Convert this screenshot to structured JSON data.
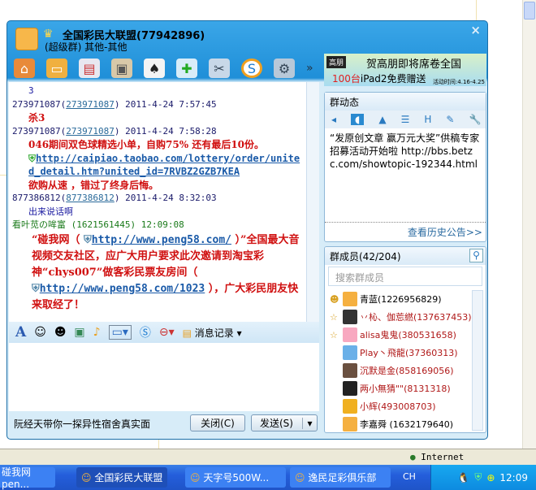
{
  "window": {
    "title": "全国彩民大联盟(77942896)",
    "subtitle": "(超级群) 其他-其他",
    "close": "×",
    "more": "»"
  },
  "chat": {
    "messages": [
      {
        "text": "3"
      },
      {
        "sender": "273971087",
        "id": "273971087",
        "time": "2011-4-24 7:57:45",
        "text": "杀3"
      },
      {
        "sender": "273971087",
        "id": "273971087",
        "time": "2011-4-24 7:58:28",
        "text": "046期间双色球精选小单，自购75%  还有最后10份。",
        "link": "http://caipiao.taobao.com/lottery/order/united_detail.htm?united_id=7RVBZ2GZB7KEA",
        "text2": "欲购从速 ，错过了终身后悔。"
      },
      {
        "sender": "877386812",
        "id": "877386812",
        "time": "2011-4-24 8:32:03",
        "text": "出来说话啊"
      },
      {
        "sender": "看叶苋の哞富",
        "id": "(1621561445)",
        "time": "12:09:08",
        "p1": "“碰我网（",
        "link1": "http://www.peng58.com/",
        "p2": "）”全国最大音视频交友社区，应广大用户要求此次邀请到淘宝彩神“chys007”做客彩民票友房间（",
        "link2": "http://www.peng58.com/1023",
        "p3": "），广大彩民朋友快来取经了！"
      }
    ]
  },
  "input_toolbar": {
    "history": "消息记录"
  },
  "bottom": {
    "ad_text": "阮经天带你一探异性宿舍真实面",
    "close": "关闭(C)",
    "send": "发送(S)"
  },
  "ad": {
    "brand": "高朋",
    "line1": "贺高朋即将席卷全国",
    "line2_red": "100台",
    "line2": "iPad2免费赠送",
    "period": "活动时间:4.16-4.25"
  },
  "announce": {
    "title": "群动态",
    "text": "“发原创文章 赢万元大奖”供稿专家招募活动开始啦 http://bbs.betzc.com/showtopic-192344.html",
    "history": "查看历史公告>>"
  },
  "members": {
    "title": "群成员(42/204)",
    "search_placeholder": "搜索群成员",
    "list": [
      {
        "name": "青蓝(1226956829)",
        "color": "#000"
      },
      {
        "name": "丷杺、伽莣繎(137637453)",
        "color": "#b01818"
      },
      {
        "name": "alisa鬼鬼(380531658)",
        "color": "#b01818"
      },
      {
        "name": "Play丶飛龍(37360313)",
        "color": "#b01818"
      },
      {
        "name": "沉默是金(858169056)",
        "color": "#b01818"
      },
      {
        "name": "两小無猜\"\"(8131318)",
        "color": "#b01818"
      },
      {
        "name": "小辉(493008703)",
        "color": "#b01818"
      },
      {
        "name": "李嘉舜 (1632179640)",
        "color": "#000"
      }
    ]
  },
  "statusbar": {
    "zone": "Internet"
  },
  "taskbar": {
    "tasks": [
      "碰我网pen...",
      "全国彩民大联盟",
      "天字号500W...",
      "逸民足彩俱乐部"
    ],
    "lang": "CH",
    "clock": "12:09"
  }
}
